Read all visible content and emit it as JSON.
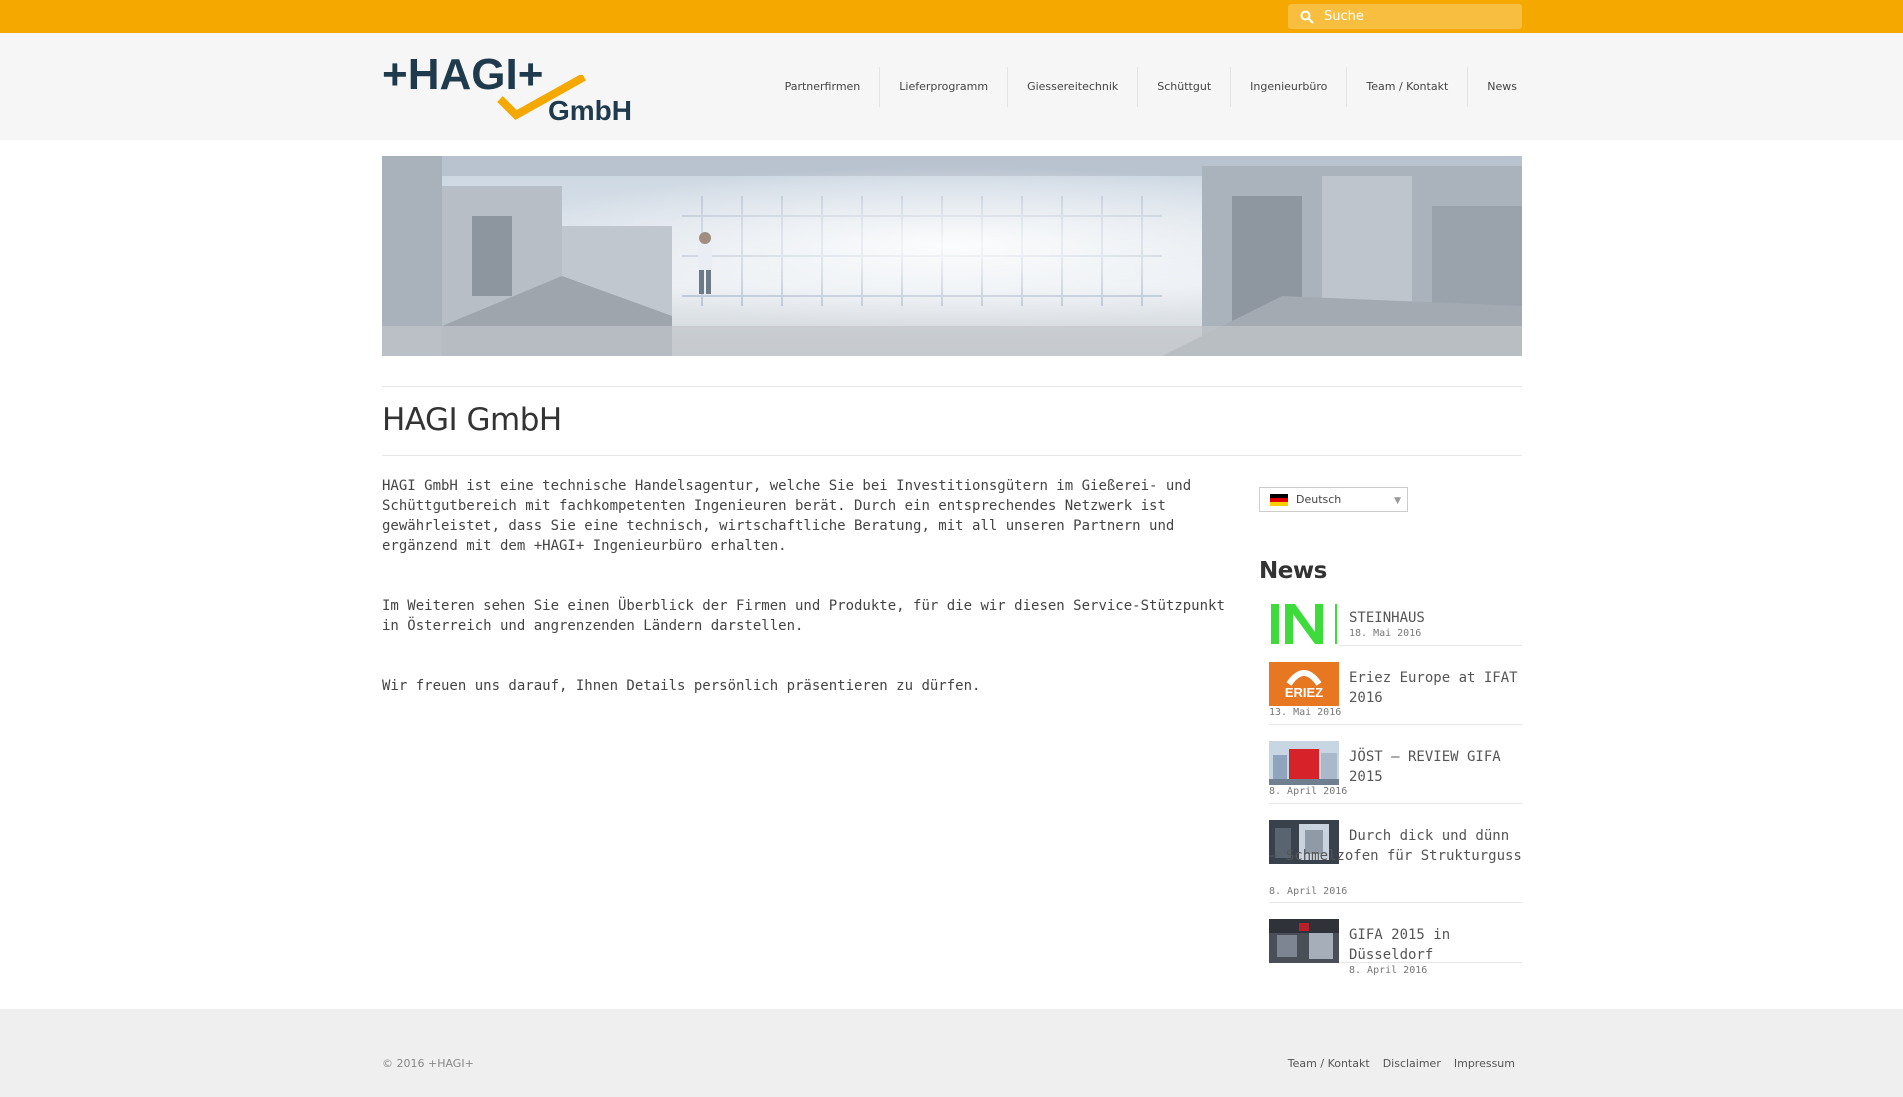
{
  "search": {
    "placeholder": "Suche"
  },
  "logo": {
    "text": "+HAGI+",
    "gmbh": "GmbH"
  },
  "nav": {
    "items": [
      "Partnerfirmen",
      "Lieferprogramm",
      "Giessereitechnik",
      "Schüttgut",
      "Ingenieurbüro",
      "Team / Kontakt",
      "News"
    ]
  },
  "page": {
    "title": "HAGI GmbH",
    "paragraphs": [
      "HAGI GmbH ist eine technische Handelsagentur, welche Sie bei Investitionsgütern im Gießerei- und Schüttgutbereich mit fachkompetenten Ingenieuren berät. Durch ein entsprechendes Netzwerk ist gewährleistet, dass Sie eine technisch, wirtschaftliche Beratung, mit all unseren Partnern und ergänzend mit dem +HAGI+ Ingenieurbüro erhalten.",
      "Im Weiteren sehen Sie einen Überblick der Firmen und Produkte, für die wir diesen Service-Stützpunkt in Österreich und angrenzenden Ländern darstellen.",
      "Wir freuen uns darauf, Ihnen Details persönlich präsentieren zu dürfen."
    ]
  },
  "sidebar": {
    "language": "Deutsch",
    "news_title": "News",
    "news": [
      {
        "title": "STEINHAUS",
        "date": "18. Mai 2016"
      },
      {
        "title": "Eriez Europe at IFAT 2016",
        "date": "13. Mai 2016"
      },
      {
        "title": "JÖST – REVIEW GIFA 2015",
        "date": "8. April 2016"
      },
      {
        "title": "Durch dick und dünn – Schmelzofen für Strukturguss",
        "date": "8. April 2016"
      },
      {
        "title": "GIFA 2015 in Düsseldorf",
        "date": "8. April 2016"
      }
    ]
  },
  "footer": {
    "copyright": "© 2016 +HAGI+",
    "links": [
      "Team / Kontakt",
      "Disclaimer",
      "Impressum"
    ]
  },
  "colors": {
    "accent": "#f5a800",
    "brand_dark": "#1e3a4c"
  }
}
